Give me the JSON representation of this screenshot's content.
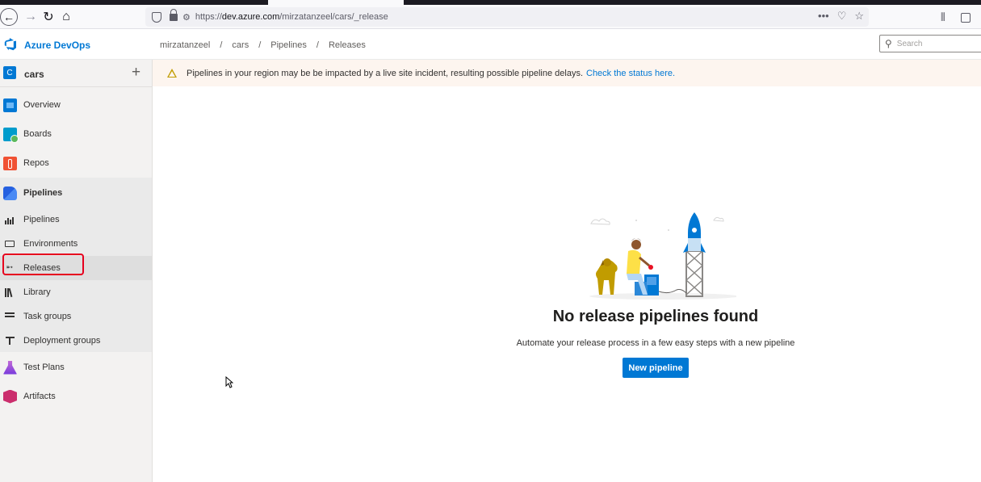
{
  "browser": {
    "url_host": "dev.azure.com",
    "url_prefix": "https://",
    "url_path": "/mirzatanzeel/cars/_release",
    "more_label": "•••"
  },
  "header": {
    "app_title": "Azure DevOps",
    "breadcrumb": [
      "mirzatanzeel",
      "cars",
      "Pipelines",
      "Releases"
    ],
    "breadcrumb_sep": "/",
    "search_placeholder": "Search"
  },
  "sidebar": {
    "project_initial": "C",
    "project_name": "cars",
    "add_label": "+",
    "items": [
      {
        "label": "Overview",
        "icon": "overview-icon"
      },
      {
        "label": "Boards",
        "icon": "boards-icon"
      },
      {
        "label": "Repos",
        "icon": "repos-icon"
      },
      {
        "label": "Pipelines",
        "icon": "pipelines-icon"
      },
      {
        "label": "Pipelines",
        "icon": "pipelines-sub-icon"
      },
      {
        "label": "Environments",
        "icon": "environments-icon"
      },
      {
        "label": "Releases",
        "icon": "releases-icon"
      },
      {
        "label": "Library",
        "icon": "library-icon"
      },
      {
        "label": "Task groups",
        "icon": "task-groups-icon"
      },
      {
        "label": "Deployment groups",
        "icon": "deployment-groups-icon"
      },
      {
        "label": "Test Plans",
        "icon": "test-plans-icon"
      },
      {
        "label": "Artifacts",
        "icon": "artifacts-icon"
      }
    ]
  },
  "banner": {
    "text": "Pipelines in your region may be be impacted by a live site incident, resulting possible pipeline delays.",
    "link": "Check the status here."
  },
  "main": {
    "title": "No release pipelines found",
    "subtitle": "Automate your release process in a few easy steps with a new pipeline",
    "button": "New pipeline"
  },
  "colors": {
    "accent": "#0078d4",
    "highlight": "#e6001e",
    "banner_bg": "#fdf5ef"
  }
}
